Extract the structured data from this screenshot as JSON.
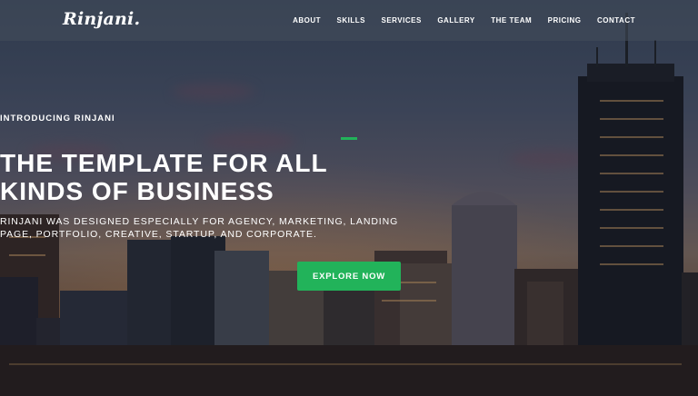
{
  "brand": {
    "logo_text": "Rinjani."
  },
  "nav": {
    "items": [
      {
        "label": "ABOUT"
      },
      {
        "label": "SKILLS"
      },
      {
        "label": "SERVICES"
      },
      {
        "label": "GALLERY"
      },
      {
        "label": "THE TEAM"
      },
      {
        "label": "PRICING"
      },
      {
        "label": "CONTACT"
      }
    ]
  },
  "hero": {
    "eyebrow": "INTRODUCING RINJANI",
    "headline_line1": "THE TEMPLATE FOR ALL",
    "headline_line2": "KINDS OF BUSINESS",
    "subline_line1": "RINJANI WAS DESIGNED ESPECIALLY FOR AGENCY, MARKETING, LANDING",
    "subline_line2": "PAGE, PORTFOLIO, CREATIVE, STARTUP, AND CORPORATE.",
    "cta_label": "EXPLORE NOW",
    "background_image": "city-skyline-at-dusk"
  },
  "colors": {
    "accent": "#22b35a",
    "navbar_bg": "#464e5c",
    "text": "#ffffff"
  }
}
